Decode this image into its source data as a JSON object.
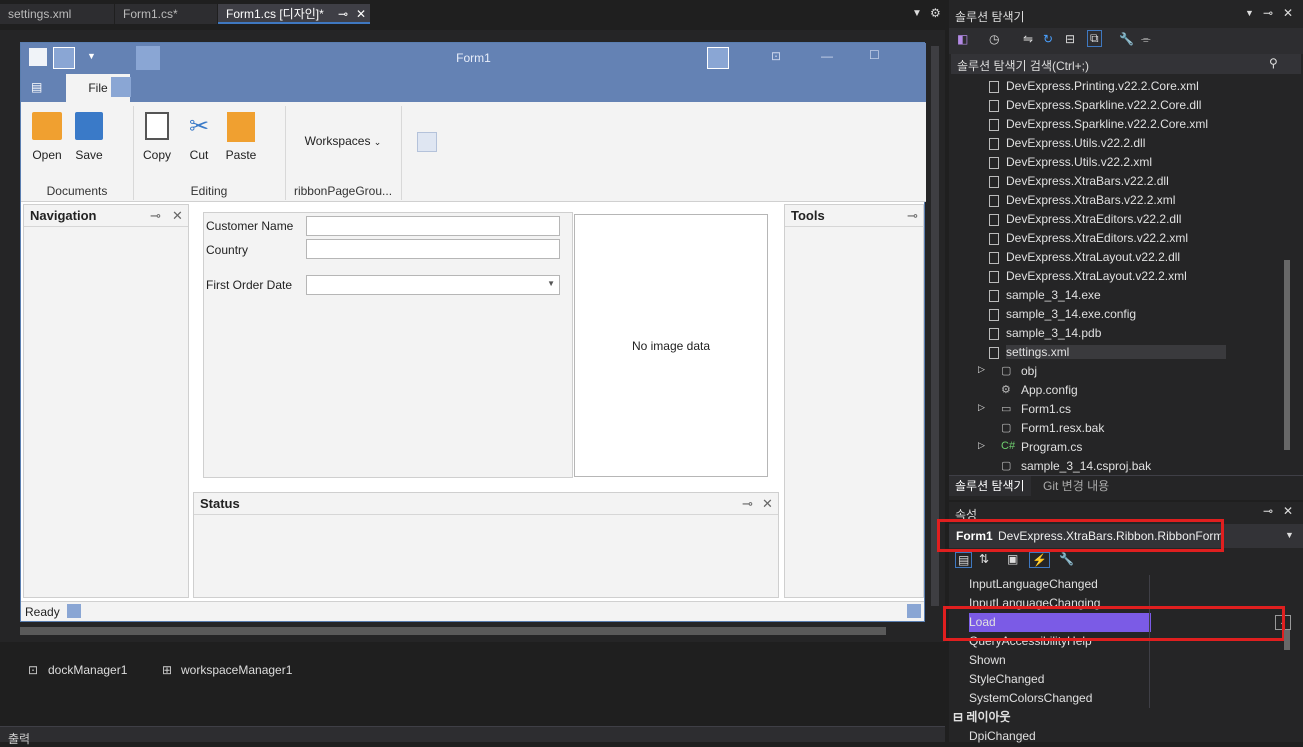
{
  "tabs": [
    "settings.xml",
    "Form1.cs*",
    "Form1.cs [디자인]*"
  ],
  "form": {
    "title": "Form1",
    "ribbon_tab": "File",
    "buttons": {
      "open": "Open",
      "save": "Save",
      "copy": "Copy",
      "cut": "Cut",
      "paste": "Paste",
      "workspaces": "Workspaces"
    },
    "groups": {
      "documents": "Documents",
      "editing": "Editing",
      "page_group": "ribbonPageGrou..."
    },
    "panels": {
      "navigation": "Navigation",
      "tools": "Tools",
      "status": "Status"
    },
    "fields": {
      "customer_name": "Customer Name",
      "country": "Country",
      "first_order_date": "First Order Date"
    },
    "no_image": "No image data",
    "status_bar": "Ready"
  },
  "components": [
    "dockManager1",
    "workspaceManager1"
  ],
  "output_label": "출력",
  "solution": {
    "title": "솔루션 탐색기",
    "search": "솔루션 탐색기 검색(Ctrl+;)",
    "files": [
      "DevExpress.Printing.v22.2.Core.xml",
      "DevExpress.Sparkline.v22.2.Core.dll",
      "DevExpress.Sparkline.v22.2.Core.xml",
      "DevExpress.Utils.v22.2.dll",
      "DevExpress.Utils.v22.2.xml",
      "DevExpress.XtraBars.v22.2.dll",
      "DevExpress.XtraBars.v22.2.xml",
      "DevExpress.XtraEditors.v22.2.dll",
      "DevExpress.XtraEditors.v22.2.xml",
      "DevExpress.XtraLayout.v22.2.dll",
      "DevExpress.XtraLayout.v22.2.xml",
      "sample_3_14.exe",
      "sample_3_14.exe.config",
      "sample_3_14.pdb",
      "settings.xml"
    ],
    "project": [
      "obj",
      "App.config",
      "Form1.cs",
      "Form1.resx.bak",
      "Program.cs",
      "sample_3_14.csproj.bak"
    ],
    "bottom_tabs": [
      "솔루션 탐색기",
      "Git 변경 내용"
    ]
  },
  "properties": {
    "title": "속성",
    "object": "Form1",
    "type": "DevExpress.XtraBars.Ribbon.RibbonForm",
    "events": [
      "InputLanguageChanged",
      "InputLanguageChanging",
      "Load",
      "QueryAccessibilityHelp",
      "Shown",
      "StyleChanged",
      "SystemColorsChanged"
    ],
    "category": "레이아웃",
    "last": "DpiChanged"
  }
}
